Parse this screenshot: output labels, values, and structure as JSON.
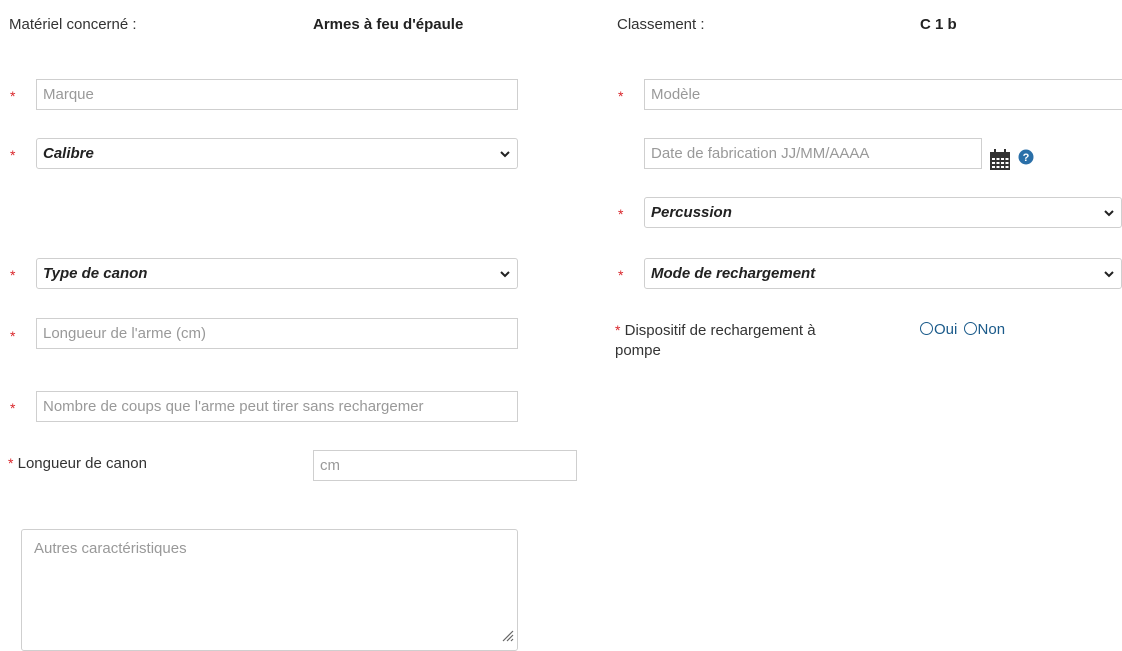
{
  "header": {
    "materiel_label": "Matériel concerné :",
    "materiel_value": "Armes à feu d'épaule",
    "classement_label": "Classement :",
    "classement_value": "C 1 b"
  },
  "required_marker": "*",
  "left": {
    "marque_placeholder": "Marque",
    "calibre_selected": "Calibre",
    "type_canon_selected": "Type de canon",
    "longueur_arme_placeholder": "Longueur de l'arme (cm)",
    "nombre_coups_placeholder": "Nombre de coups que l'arme peut tirer sans rechargemer",
    "longueur_canon_label": "Longueur de canon",
    "longueur_canon_placeholder": "cm",
    "autres_placeholder": "Autres caractéristiques"
  },
  "right": {
    "modele_placeholder": "Modèle",
    "date_placeholder": "Date de fabrication JJ/MM/AAAA",
    "percussion_selected": "Percussion",
    "mode_rechargement_selected": "Mode de rechargement",
    "dispositif_label_line1": "Dispositif de rechargement à",
    "dispositif_label_line2": "pompe",
    "radio_oui": "Oui",
    "radio_non": "Non"
  },
  "icons": {
    "calendar": "calendar-icon",
    "help": "help-icon",
    "chevron": "chevron-down-icon"
  },
  "colors": {
    "required": "#d9252a",
    "radio_text": "#1a5a8a",
    "help_icon": "#2a6fa8"
  }
}
